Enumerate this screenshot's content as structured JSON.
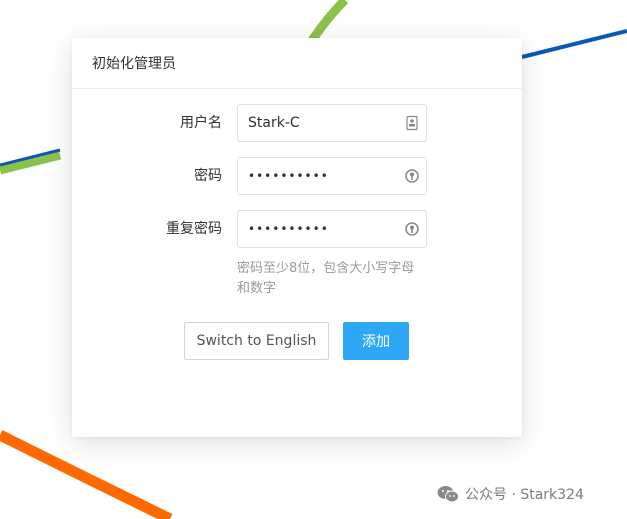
{
  "dialog": {
    "title": "初始化管理员"
  },
  "form": {
    "username": {
      "label": "用户名",
      "value": "Stark-C"
    },
    "password": {
      "label": "密码",
      "value": "••••••••••"
    },
    "confirm_password": {
      "label": "重复密码",
      "value": "••••••••••"
    },
    "hint": "密码至少8位，包含大小写字母和数字"
  },
  "buttons": {
    "switch_language": "Switch to English",
    "add": "添加"
  },
  "watermark": {
    "text": "公众号 · Stark324"
  },
  "colors": {
    "primary_button": "#2ea7f7",
    "line_green": "#8bc34a",
    "line_blue": "#0b58b5",
    "line_orange": "#ff6a00"
  }
}
